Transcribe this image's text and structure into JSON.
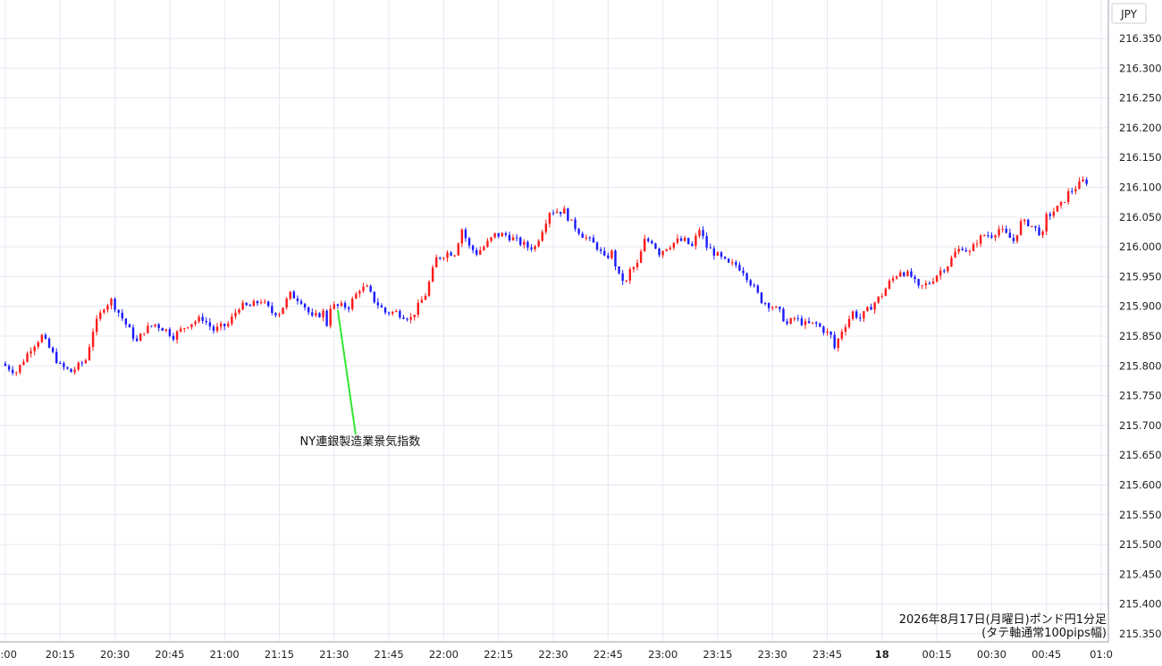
{
  "chart_data": {
    "type": "candlestick",
    "currency_label": "JPY",
    "ylim": [
      215.33,
      216.41
    ],
    "y_ticks": [
      "216.350",
      "216.300",
      "216.250",
      "216.200",
      "216.150",
      "216.100",
      "216.050",
      "216.000",
      "215.950",
      "215.900",
      "215.850",
      "215.800",
      "215.750",
      "215.700",
      "215.650",
      "215.600",
      "215.550",
      "215.500",
      "215.450",
      "215.400",
      "215.350"
    ],
    "x_ticks": [
      "0:00",
      "20:15",
      "20:30",
      "20:45",
      "21:00",
      "21:15",
      "21:30",
      "21:45",
      "22:00",
      "22:15",
      "22:30",
      "22:45",
      "23:00",
      "23:15",
      "23:30",
      "23:45",
      "18",
      "00:15",
      "00:30",
      "00:45",
      "01:0"
    ],
    "bold_x_tick": "18",
    "up_color": "#ff1a1a",
    "down_color": "#1a1aff",
    "annotation_line_color": "#33e633",
    "annotation": {
      "text": "NY連銀製造業景気指数",
      "time": "21:31"
    },
    "caption_line1": "2026年8月17日(月曜日)ポンド円1分足",
    "caption_line2": "(タテ軸通常100pips幅)",
    "close_path": [
      [
        0,
        215.8
      ],
      [
        3,
        215.79
      ],
      [
        7,
        215.83
      ],
      [
        10,
        215.85
      ],
      [
        13,
        215.82
      ],
      [
        15,
        215.8
      ],
      [
        18,
        215.79
      ],
      [
        22,
        215.81
      ],
      [
        24,
        215.86
      ],
      [
        27,
        215.9
      ],
      [
        29,
        215.91
      ],
      [
        31,
        215.89
      ],
      [
        33,
        215.87
      ],
      [
        36,
        215.84
      ],
      [
        38,
        215.86
      ],
      [
        41,
        215.87
      ],
      [
        44,
        215.86
      ],
      [
        46,
        215.85
      ],
      [
        50,
        215.87
      ],
      [
        54,
        215.88
      ],
      [
        57,
        215.86
      ],
      [
        61,
        215.87
      ],
      [
        64,
        215.9
      ],
      [
        67,
        215.9
      ],
      [
        70,
        215.91
      ],
      [
        73,
        215.89
      ],
      [
        75,
        215.89
      ],
      [
        78,
        215.92
      ],
      [
        81,
        215.91
      ],
      [
        84,
        215.88
      ],
      [
        87,
        215.89
      ],
      [
        88,
        215.87
      ],
      [
        89,
        215.9
      ],
      [
        94,
        215.9
      ],
      [
        97,
        215.93
      ],
      [
        99,
        215.93
      ],
      [
        101,
        215.91
      ],
      [
        104,
        215.89
      ],
      [
        107,
        215.89
      ],
      [
        111,
        215.88
      ],
      [
        115,
        215.92
      ],
      [
        118,
        215.98
      ],
      [
        121,
        215.99
      ],
      [
        123,
        215.99
      ],
      [
        125,
        216.03
      ],
      [
        127,
        216.0
      ],
      [
        129,
        215.99
      ],
      [
        131,
        216.0
      ],
      [
        134,
        216.02
      ],
      [
        137,
        216.02
      ],
      [
        140,
        216.01
      ],
      [
        143,
        216.0
      ],
      [
        145,
        216.0
      ],
      [
        147,
        216.03
      ],
      [
        149,
        216.06
      ],
      [
        153,
        216.06
      ],
      [
        155,
        216.04
      ],
      [
        158,
        216.02
      ],
      [
        162,
        216.0
      ],
      [
        164,
        215.98
      ],
      [
        166,
        215.99
      ],
      [
        168,
        215.95
      ],
      [
        170,
        215.94
      ],
      [
        171,
        215.96
      ],
      [
        173,
        215.97
      ],
      [
        175,
        216.01
      ],
      [
        177,
        216.01
      ],
      [
        179,
        215.99
      ],
      [
        181,
        216.0
      ],
      [
        184,
        216.01
      ],
      [
        186,
        216.01
      ],
      [
        188,
        216.0
      ],
      [
        190,
        216.03
      ],
      [
        192,
        216.0
      ],
      [
        194,
        215.99
      ],
      [
        196,
        215.98
      ],
      [
        198,
        215.97
      ],
      [
        200,
        215.97
      ],
      [
        202,
        215.96
      ],
      [
        204,
        215.94
      ],
      [
        207,
        215.91
      ],
      [
        210,
        215.9
      ],
      [
        212,
        215.89
      ],
      [
        214,
        215.87
      ],
      [
        216,
        215.88
      ],
      [
        219,
        215.87
      ],
      [
        222,
        215.87
      ],
      [
        224,
        215.86
      ],
      [
        226,
        215.85
      ],
      [
        227,
        215.83
      ],
      [
        229,
        215.86
      ],
      [
        231,
        215.88
      ],
      [
        232,
        215.89
      ],
      [
        234,
        215.88
      ],
      [
        237,
        215.9
      ],
      [
        240,
        215.92
      ],
      [
        242,
        215.94
      ],
      [
        245,
        215.96
      ],
      [
        248,
        215.95
      ],
      [
        250,
        215.93
      ],
      [
        253,
        215.94
      ],
      [
        256,
        215.96
      ],
      [
        258,
        215.97
      ],
      [
        260,
        215.99
      ],
      [
        262,
        216.0
      ],
      [
        264,
        215.99
      ],
      [
        266,
        216.01
      ],
      [
        268,
        216.02
      ],
      [
        270,
        216.02
      ],
      [
        272,
        216.03
      ],
      [
        274,
        216.02
      ],
      [
        276,
        216.01
      ],
      [
        278,
        216.04
      ],
      [
        280,
        216.04
      ],
      [
        282,
        216.03
      ],
      [
        284,
        216.02
      ],
      [
        285,
        216.05
      ],
      [
        287,
        216.06
      ],
      [
        289,
        216.07
      ],
      [
        291,
        216.09
      ],
      [
        293,
        216.1
      ],
      [
        295,
        216.11
      ],
      [
        296,
        216.11
      ]
    ]
  }
}
